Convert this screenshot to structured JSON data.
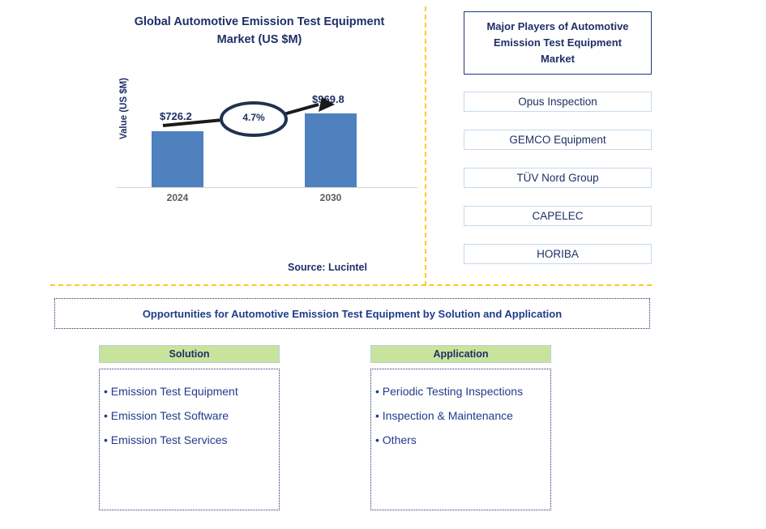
{
  "chart_panel": {
    "title": "Global Automotive Emission Test Equipment Market (US $M)",
    "title_line1": "Global Automotive Emission Test Equipment",
    "title_line2": "Market (US $M)",
    "source": "Source: Lucintel"
  },
  "chart_data": {
    "type": "bar",
    "title": "Global Automotive Emission Test Equipment Market (US $M)",
    "xlabel": "",
    "ylabel": "Value (US $M)",
    "categories": [
      "2024",
      "2030"
    ],
    "values": [
      726.2,
      969.8
    ],
    "value_labels": [
      "$726.2",
      "$969.8"
    ],
    "ylim": [
      0,
      1050
    ],
    "grid": false,
    "legend": "none",
    "bar_color": "#4E81BD",
    "annotation": {
      "label": "4.7%",
      "type": "cagr-callout",
      "shape": "ellipse-with-arrow"
    }
  },
  "players_panel": {
    "header": "Major Players of Automotive Emission Test Equipment Market",
    "header_line1": "Major Players of Automotive",
    "header_line2": "Emission Test Equipment",
    "header_line3": "Market",
    "items": [
      {
        "label": "Opus Inspection"
      },
      {
        "label": "GEMCO Equipment"
      },
      {
        "label": "TÜV Nord Group"
      },
      {
        "label": "CAPELEC"
      },
      {
        "label": "HORIBA"
      }
    ]
  },
  "opportunities": {
    "banner": "Opportunities for Automotive Emission Test Equipment by Solution and Application",
    "columns": [
      {
        "header": "Solution",
        "items": [
          "Emission Test Equipment",
          "Emission Test Software",
          "Emission Test Services"
        ]
      },
      {
        "header": "Application",
        "items": [
          "Periodic Testing Inspections",
          "Inspection & Maintenance",
          "Others"
        ]
      }
    ]
  },
  "colors": {
    "navy": "#1F2F66",
    "bar_blue": "#4E81BD",
    "divider_gold": "#FFC81E",
    "header_green": "#C8E49C",
    "box_border_blue": "#C5D9ED"
  }
}
